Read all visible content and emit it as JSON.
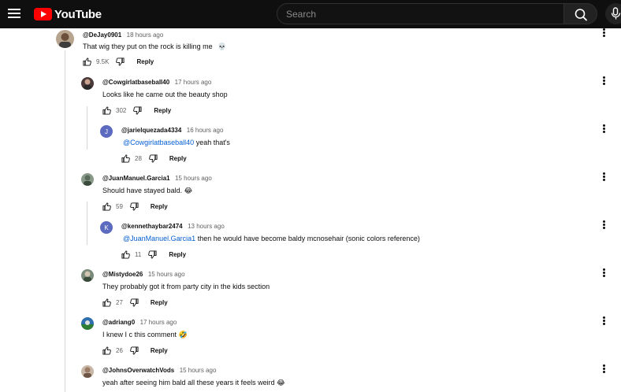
{
  "header": {
    "logo_text": "YouTube",
    "search_placeholder": "Search"
  },
  "comments": [
    {
      "author": "@DeJay0901",
      "time": "18 hours ago",
      "text": "That wig they put on the rock is killing me",
      "emoji": "💀",
      "likes": "9.5K",
      "reply_label": "Reply"
    },
    {
      "author": "@Cowgirlatbaseball40",
      "time": "17 hours ago",
      "text": "Looks like he came out the beauty shop",
      "likes": "302",
      "reply_label": "Reply"
    },
    {
      "author": "@jarielquezada4334",
      "time": "16 hours ago",
      "avatar_letter": "J",
      "mention": "@Cowgirlatbaseball40",
      "text": " yeah that's",
      "likes": "28",
      "reply_label": "Reply"
    },
    {
      "author": "@JuanManuel.Garcia1",
      "time": "15 hours ago",
      "text": "Should have stayed bald.",
      "emoji": "😂",
      "likes": "59",
      "reply_label": "Reply"
    },
    {
      "author": "@kennethaybar2474",
      "time": "13 hours ago",
      "avatar_letter": "K",
      "mention": "@JuanManuel.Garcia1",
      "text": " then he would have become baldy mcnosehair (sonic colors reference)",
      "likes": "11",
      "reply_label": "Reply"
    },
    {
      "author": "@Mistydoe26",
      "time": "15 hours ago",
      "text": "They probably got it from party city in the kids section",
      "likes": "27",
      "reply_label": "Reply"
    },
    {
      "author": "@adriang0",
      "time": "17 hours ago",
      "text": "I knew I c this comment",
      "emoji": "🤣",
      "likes": "26",
      "reply_label": "Reply"
    },
    {
      "author": "@JohnsOverwatchVods",
      "time": "15 hours ago",
      "text": "yeah after seeing him bald all these years it feels weird",
      "emoji": "😂"
    }
  ],
  "colors": {
    "header_bg": "#0f0f0f",
    "logo_red": "#ff0000",
    "mention_blue": "#065fd4",
    "avatar_j": "#5c6bc0",
    "avatar_k": "#5c6bc0"
  }
}
